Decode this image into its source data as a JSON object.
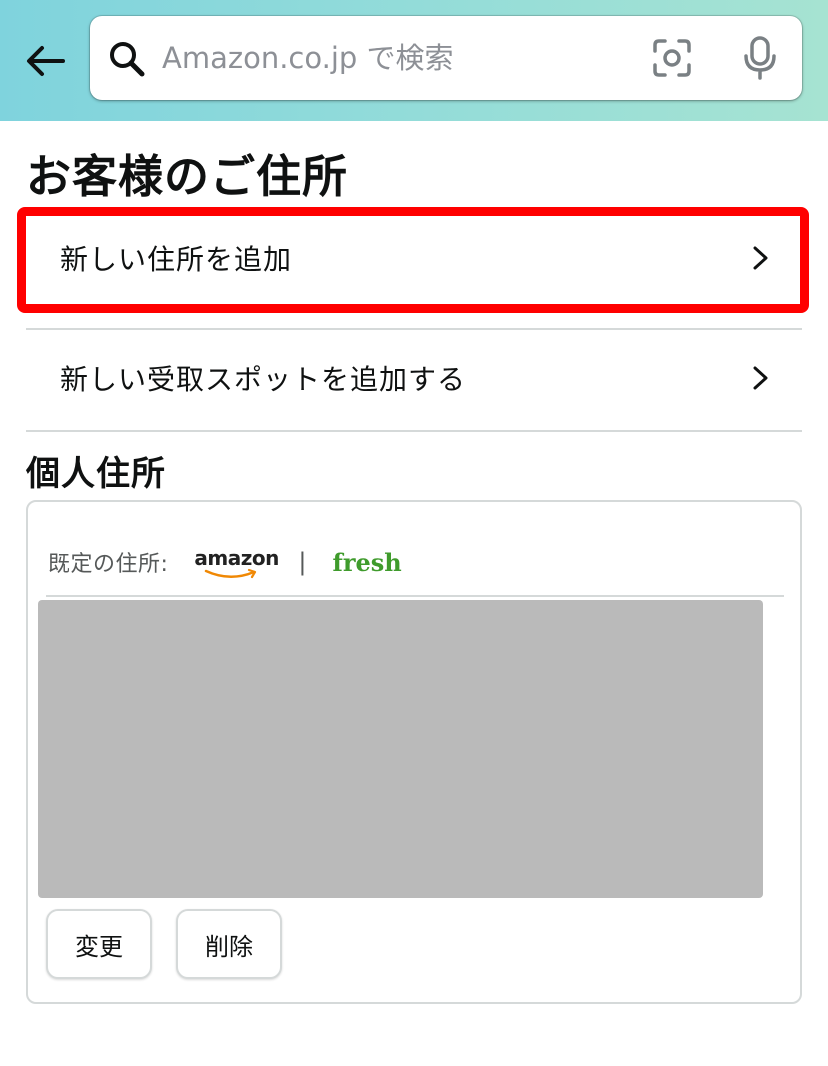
{
  "header": {
    "search_placeholder": "Amazon.co.jp で検索"
  },
  "page": {
    "title": "お客様のご住所"
  },
  "actions": {
    "add_address": "新しい住所を追加",
    "add_pickup_spot": "新しい受取スポットを追加する"
  },
  "personal": {
    "section_title": "個人住所",
    "default_label": "既定の住所:",
    "amazon_logo_text": "amazon",
    "separator": "|",
    "fresh_logo_text": "fresh",
    "edit_button": "変更",
    "delete_button": "削除"
  },
  "colors": {
    "highlight": "#ff0000",
    "fresh_green": "#3f9b2c",
    "amazon_orange": "#f08804",
    "redacted": "#bababa"
  },
  "icons": {
    "back": "arrow-left-icon",
    "search": "search-icon",
    "camera": "camera-scan-icon",
    "mic": "microphone-icon",
    "chevron": "chevron-right-icon"
  }
}
